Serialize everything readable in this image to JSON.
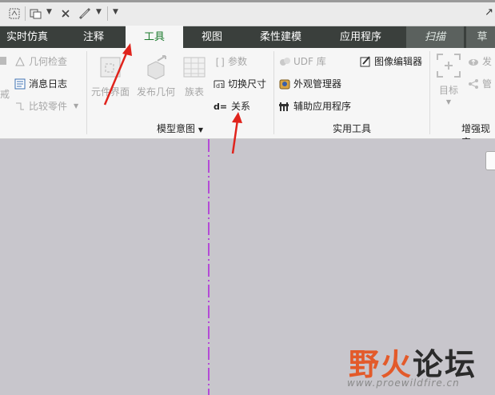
{
  "tabs": [
    {
      "label": "实时仿真"
    },
    {
      "label": "注释"
    },
    {
      "label": "工具"
    },
    {
      "label": "视图"
    },
    {
      "label": "柔性建模"
    },
    {
      "label": "应用程序"
    },
    {
      "label": "扫描"
    },
    {
      "label": "草"
    }
  ],
  "active_tab": "工具",
  "ribbon": {
    "investigate": {
      "geometry_check": "几何检查",
      "message_log": "消息日志",
      "compare_parts": "比较零件",
      "partial_label": "戒"
    },
    "model_intent": {
      "component_interface": "元件界面",
      "publish_geometry": "发布几何",
      "family_table": "族表",
      "parameters": "参数",
      "switch_dimensions": "切换尺寸",
      "relations": "关系",
      "group_label": "模型意图"
    },
    "utilities": {
      "udf_library": "UDF 库",
      "image_editor": "图像编辑器",
      "appearance_manager": "外观管理器",
      "auxiliary_apps": "辅助应用程序",
      "group_label": "实用工具"
    },
    "augmented_reality": {
      "target": "目标",
      "publish_partial": "发",
      "manage_partial": "管",
      "group_label": "增强现实"
    }
  },
  "watermark": {
    "brand_accent": "野火",
    "brand_rest": "论坛",
    "url": "www.proewildfire.cn"
  },
  "colors": {
    "tab_bar": "#3a3f3c",
    "active_tab_text": "#1c7a2e",
    "ribbon_bg": "#f6f6f6",
    "canvas_bg": "#c8c6cc",
    "axis_line": "#b44bd6",
    "annotation_arrow": "#e0231c",
    "watermark_accent": "#e35a2a"
  },
  "icons": {
    "qat": [
      "regenerate-icon",
      "copy-window-icon",
      "close-window-icon",
      "measure-icon",
      "customize-dropdown-icon"
    ]
  }
}
